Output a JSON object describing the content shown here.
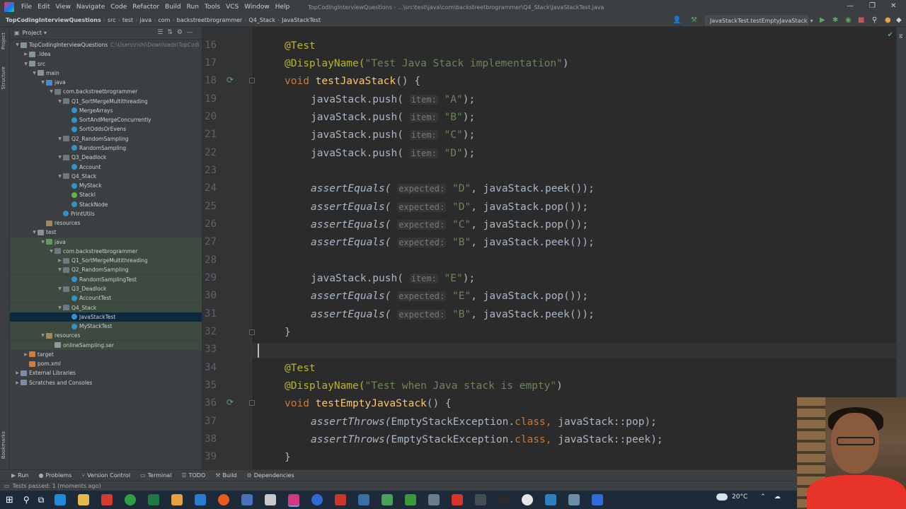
{
  "titlebar": {
    "menu": [
      "File",
      "Edit",
      "View",
      "Navigate",
      "Code",
      "Refactor",
      "Build",
      "Run",
      "Tools",
      "VCS",
      "Window",
      "Help"
    ],
    "window_title": "TopCodingInterviewQuestions - ...\\src\\test\\java\\com\\backstreetbrogrammer\\Q4_Stack\\JavaStackTest.java"
  },
  "navbar": {
    "breadcrumbs": [
      "TopCodingInterviewQuestions",
      "src",
      "test",
      "java",
      "com",
      "backstreetbrogrammer",
      "Q4_Stack",
      "JavaStackTest"
    ],
    "run_config": "JavaStackTest.testEmptyJavaStack"
  },
  "left_strip": {
    "tabs": [
      "Project",
      "Structure",
      "Bookmarks"
    ]
  },
  "project_panel": {
    "title": "Project",
    "tree": [
      {
        "label": "TopCodingInterviewQuestions",
        "path": "C:\\Users\\rishi\\Downloads\\TopCodi",
        "icon": "folder",
        "indent": 0,
        "open": true
      },
      {
        "label": ".idea",
        "icon": "folder",
        "indent": 1,
        "open": false
      },
      {
        "label": "src",
        "icon": "folder",
        "indent": 1,
        "open": true
      },
      {
        "label": "main",
        "icon": "folder",
        "indent": 2,
        "open": true
      },
      {
        "label": "java",
        "icon": "src",
        "indent": 3,
        "open": true
      },
      {
        "label": "com.backstreetbrogrammer",
        "icon": "pkg",
        "indent": 4,
        "open": true
      },
      {
        "label": "Q1_SortMergeMultithreading",
        "icon": "pkg",
        "indent": 5,
        "open": true
      },
      {
        "label": "MergeArrays",
        "icon": "cls",
        "indent": 6
      },
      {
        "label": "SortAndMergeConcurrently",
        "icon": "cls",
        "indent": 6
      },
      {
        "label": "SortOddsOrEvens",
        "icon": "cls",
        "indent": 6
      },
      {
        "label": "Q2_RandomSampling",
        "icon": "pkg",
        "indent": 5,
        "open": true
      },
      {
        "label": "RandomSampling",
        "icon": "cls",
        "indent": 6
      },
      {
        "label": "Q3_Deadlock",
        "icon": "pkg",
        "indent": 5,
        "open": true
      },
      {
        "label": "Account",
        "icon": "cls",
        "indent": 6
      },
      {
        "label": "Q4_Stack",
        "icon": "pkg",
        "indent": 5,
        "open": true
      },
      {
        "label": "MyStack",
        "icon": "cls",
        "indent": 6
      },
      {
        "label": "StackI",
        "icon": "iface",
        "indent": 6
      },
      {
        "label": "StackNode",
        "icon": "cls",
        "indent": 6
      },
      {
        "label": "PrintUtils",
        "icon": "cls",
        "indent": 5
      },
      {
        "label": "resources",
        "icon": "res",
        "indent": 3
      },
      {
        "label": "test",
        "icon": "folder",
        "indent": 2,
        "open": true
      },
      {
        "label": "java",
        "icon": "test",
        "indent": 3,
        "open": true,
        "hl": true
      },
      {
        "label": "com.backstreetbrogrammer",
        "icon": "pkg",
        "indent": 4,
        "open": true,
        "hl": true
      },
      {
        "label": "Q1_SortMergeMultithreading",
        "icon": "pkg",
        "indent": 5,
        "open": false,
        "hl": true
      },
      {
        "label": "Q2_RandomSampling",
        "icon": "pkg",
        "indent": 5,
        "open": true,
        "hl": true
      },
      {
        "label": "RandomSamplingTest",
        "icon": "cls",
        "indent": 6,
        "hl": true
      },
      {
        "label": "Q3_Deadlock",
        "icon": "pkg",
        "indent": 5,
        "open": true,
        "hl": true
      },
      {
        "label": "AccountTest",
        "icon": "cls",
        "indent": 6,
        "hl": true
      },
      {
        "label": "Q4_Stack",
        "icon": "pkg",
        "indent": 5,
        "open": true,
        "hl": true
      },
      {
        "label": "JavaStackTest",
        "icon": "cls",
        "indent": 6,
        "sel": true
      },
      {
        "label": "MyStackTest",
        "icon": "cls",
        "indent": 6,
        "hl": true
      },
      {
        "label": "resources",
        "icon": "res",
        "indent": 3,
        "open": true,
        "hl": true
      },
      {
        "label": "onlineSampling.ser",
        "icon": "file",
        "indent": 4,
        "hl": true
      },
      {
        "label": "target",
        "icon": "xml",
        "indent": 1,
        "open": false
      },
      {
        "label": "pom.xml",
        "icon": "xml",
        "indent": 1
      },
      {
        "label": "External Libraries",
        "icon": "lib",
        "indent": 0,
        "open": false
      },
      {
        "label": "Scratches and Consoles",
        "icon": "lib",
        "indent": 0,
        "open": false
      }
    ]
  },
  "editor": {
    "line_numbers": [
      "16",
      "17",
      "18",
      "19",
      "20",
      "21",
      "22",
      "23",
      "24",
      "25",
      "26",
      "27",
      "28",
      "29",
      "30",
      "31",
      "32",
      "33",
      "34",
      "35",
      "36",
      "37",
      "38",
      "39"
    ],
    "code": {
      "l16": "@Test",
      "l17_ann": "@DisplayName(",
      "l17_str": "\"Test Java Stack implementation\"",
      "l17_end": ")",
      "kw_void": "void ",
      "l18_fn": "testJavaStack",
      "l18_end": "() {",
      "push": "javaStack.push(",
      "hint_item": "item:",
      "hint_expected": "expected:",
      "assert_eq": "assertEquals(",
      "peek_end": ", javaStack.peek());",
      "pop_end": ", javaStack.pop());",
      "close_paren_semi": ");",
      "str_A": "\"A\"",
      "str_B": "\"B\"",
      "str_C": "\"C\"",
      "str_D": "\"D\"",
      "str_E": "\"E\"",
      "close_brace": "}",
      "l34": "@Test",
      "l35_str": "\"Test when Java stack is empty\"",
      "l36_fn": "testEmptyJavaStack",
      "assert_throws": "assertThrows(",
      "exc_class": "EmptyStackException.",
      "kw_class": "class",
      "sep": ", ",
      "pop_ref": "javaStack::pop",
      "peek_ref": "javaStack::peek"
    }
  },
  "bottom_tabs": [
    "Run",
    "Problems",
    "Version Control",
    "Terminal",
    "TODO",
    "Build",
    "Dependencies"
  ],
  "status": "Tests passed: 1 (moments ago)",
  "taskbar": {
    "weather": "20°C"
  },
  "colors": {
    "accent": "#4a88c7",
    "editor_bg": "#2b2b2b",
    "panel_bg": "#3c3f41"
  }
}
